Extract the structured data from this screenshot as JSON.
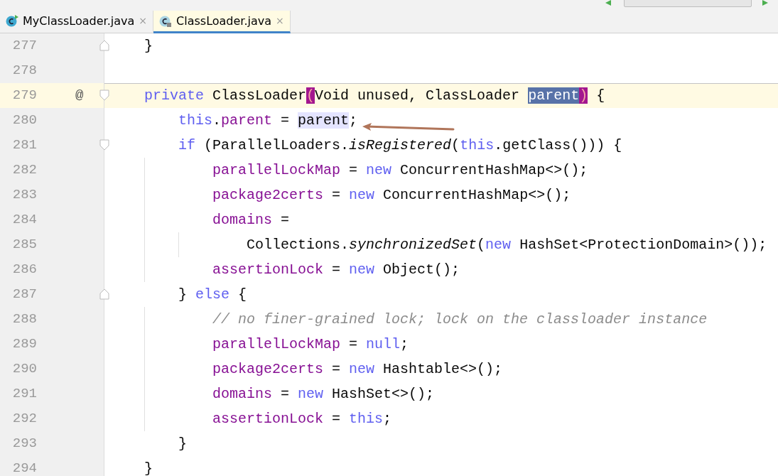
{
  "tabs": [
    {
      "label": "MyClassLoader.java",
      "selected": false,
      "locked": false,
      "close": "×"
    },
    {
      "label": "ClassLoader.java",
      "selected": true,
      "locked": true,
      "close": "×"
    }
  ],
  "lines": [
    {
      "number": "277",
      "fold_start": false,
      "fold_end": true,
      "current": false,
      "separator": false,
      "tokens": [
        {
          "text": "    }",
          "kind": "plain"
        }
      ]
    },
    {
      "number": "278",
      "fold_start": false,
      "fold_end": false,
      "current": false,
      "separator": false
    },
    {
      "number": "279",
      "fold_start": true,
      "fold_end": false,
      "current": true,
      "separator": true,
      "gutter_mark": "@",
      "tokens": [
        {
          "text": "    private",
          "kind": "keyword"
        },
        {
          "text": " ClassLoader",
          "kind": "plain"
        },
        {
          "text": "(",
          "kind": "brace-match"
        },
        {
          "text": "Void unused, ClassLoader ",
          "kind": "plain"
        },
        {
          "text": "parent",
          "kind": "selection"
        },
        {
          "text": ")",
          "kind": "brace-match"
        },
        {
          "text": " {",
          "kind": "plain"
        }
      ]
    },
    {
      "number": "280",
      "fold_start": false,
      "fold_end": false,
      "current": false,
      "separator": false,
      "tokens": [
        {
          "text": "        this",
          "kind": "keyword"
        },
        {
          "text": ".",
          "kind": "plain"
        },
        {
          "text": "parent",
          "kind": "field"
        },
        {
          "text": " = ",
          "kind": "plain"
        },
        {
          "text": "parent",
          "kind": "usage"
        },
        {
          "text": ";",
          "kind": "plain"
        }
      ]
    },
    {
      "number": "281",
      "fold_start": true,
      "fold_end": false,
      "current": false,
      "separator": false,
      "tokens": [
        {
          "text": "        if",
          "kind": "keyword"
        },
        {
          "text": " (ParallelLoaders.",
          "kind": "plain"
        },
        {
          "text": "isRegistered",
          "kind": "static"
        },
        {
          "text": "(",
          "kind": "plain"
        },
        {
          "text": "this",
          "kind": "keyword"
        },
        {
          "text": ".getClass())) {",
          "kind": "plain"
        }
      ]
    },
    {
      "number": "282",
      "fold_start": false,
      "fold_end": false,
      "current": false,
      "separator": false,
      "tokens": [
        {
          "text": "            parallelLockMap",
          "kind": "field"
        },
        {
          "text": " = ",
          "kind": "plain"
        },
        {
          "text": "new",
          "kind": "keyword"
        },
        {
          "text": " ConcurrentHashMap<>();",
          "kind": "plain"
        }
      ]
    },
    {
      "number": "283",
      "fold_start": false,
      "fold_end": false,
      "current": false,
      "separator": false,
      "tokens": [
        {
          "text": "            package2certs",
          "kind": "field"
        },
        {
          "text": " = ",
          "kind": "plain"
        },
        {
          "text": "new",
          "kind": "keyword"
        },
        {
          "text": " ConcurrentHashMap<>();",
          "kind": "plain"
        }
      ]
    },
    {
      "number": "284",
      "fold_start": false,
      "fold_end": false,
      "current": false,
      "separator": false,
      "tokens": [
        {
          "text": "            domains",
          "kind": "field"
        },
        {
          "text": " =",
          "kind": "plain"
        }
      ]
    },
    {
      "number": "285",
      "fold_start": false,
      "fold_end": false,
      "current": false,
      "separator": false,
      "tokens": [
        {
          "text": "                Collections.",
          "kind": "plain"
        },
        {
          "text": "synchronizedSet",
          "kind": "static"
        },
        {
          "text": "(",
          "kind": "plain"
        },
        {
          "text": "new",
          "kind": "keyword"
        },
        {
          "text": " HashSet<ProtectionDomain>());",
          "kind": "plain"
        }
      ]
    },
    {
      "number": "286",
      "fold_start": false,
      "fold_end": false,
      "current": false,
      "separator": false,
      "tokens": [
        {
          "text": "            assertionLock",
          "kind": "field"
        },
        {
          "text": " = ",
          "kind": "plain"
        },
        {
          "text": "new",
          "kind": "keyword"
        },
        {
          "text": " Object();",
          "kind": "plain"
        }
      ]
    },
    {
      "number": "287",
      "fold_start": false,
      "fold_end": true,
      "current": false,
      "separator": false,
      "tokens": [
        {
          "text": "        } ",
          "kind": "plain"
        },
        {
          "text": "else",
          "kind": "keyword"
        },
        {
          "text": " {",
          "kind": "plain"
        }
      ]
    },
    {
      "number": "288",
      "fold_start": false,
      "fold_end": false,
      "current": false,
      "separator": false,
      "tokens": [
        {
          "text": "            // no finer-grained lock; lock on the classloader instance",
          "kind": "comment"
        }
      ]
    },
    {
      "number": "289",
      "fold_start": false,
      "fold_end": false,
      "current": false,
      "separator": false,
      "tokens": [
        {
          "text": "            parallelLockMap",
          "kind": "field"
        },
        {
          "text": " = ",
          "kind": "plain"
        },
        {
          "text": "null",
          "kind": "keyword"
        },
        {
          "text": ";",
          "kind": "plain"
        }
      ]
    },
    {
      "number": "290",
      "fold_start": false,
      "fold_end": false,
      "current": false,
      "separator": false,
      "tokens": [
        {
          "text": "            package2certs",
          "kind": "field"
        },
        {
          "text": " = ",
          "kind": "plain"
        },
        {
          "text": "new",
          "kind": "keyword"
        },
        {
          "text": " Hashtable<>();",
          "kind": "plain"
        }
      ]
    },
    {
      "number": "291",
      "fold_start": false,
      "fold_end": false,
      "current": false,
      "separator": false,
      "tokens": [
        {
          "text": "            domains",
          "kind": "field"
        },
        {
          "text": " = ",
          "kind": "plain"
        },
        {
          "text": "new",
          "kind": "keyword"
        },
        {
          "text": " HashSet<>();",
          "kind": "plain"
        }
      ]
    },
    {
      "number": "292",
      "fold_start": false,
      "fold_end": false,
      "current": false,
      "separator": false,
      "tokens": [
        {
          "text": "            assertionLock",
          "kind": "field"
        },
        {
          "text": " = ",
          "kind": "plain"
        },
        {
          "text": "this",
          "kind": "keyword"
        },
        {
          "text": ";",
          "kind": "plain"
        }
      ]
    },
    {
      "number": "293",
      "fold_start": false,
      "fold_end": false,
      "current": false,
      "separator": false,
      "tokens": [
        {
          "text": "        }",
          "kind": "plain"
        }
      ]
    },
    {
      "number": "294",
      "fold_start": false,
      "fold_end": false,
      "current": false,
      "separator": false,
      "tokens": [
        {
          "text": "    }",
          "kind": "plain"
        }
      ]
    }
  ]
}
